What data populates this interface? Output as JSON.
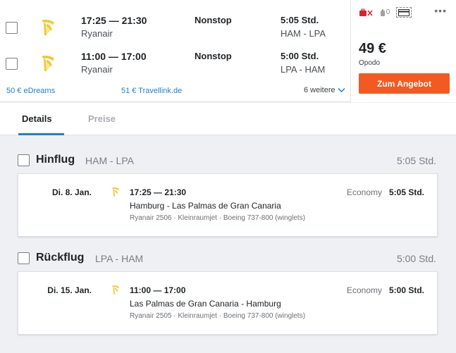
{
  "result": {
    "legs": [
      {
        "times": "17:25 — 21:30",
        "airline": "Ryanair",
        "stops": "Nonstop",
        "duration": "5:05 Std.",
        "route": "HAM - LPA",
        "logo": "ryanair-harp-icon"
      },
      {
        "times": "11:00 — 17:00",
        "airline": "Ryanair",
        "stops": "Nonstop",
        "duration": "5:00 Std.",
        "route": "LPA - HAM",
        "logo": "ryanair-harp-icon"
      }
    ],
    "providers": [
      {
        "label": "50 € eDreams"
      },
      {
        "label": "51 € Travellink.de"
      }
    ],
    "more_label": "6 weitere",
    "icons": {
      "bag_count": "0"
    },
    "price": "49 €",
    "vendor": "Opodo",
    "offer_button": "Zum Angebot",
    "colors": {
      "accent": "#1f7ecf",
      "cta": "#f25a22",
      "baggage_alert": "#d5242e"
    }
  },
  "tabs": [
    {
      "label": "Details",
      "active": true
    },
    {
      "label": "Preise",
      "active": false
    }
  ],
  "sections": [
    {
      "title": "Hinflug",
      "route": "HAM - LPA",
      "duration": "5:05 Std.",
      "segment": {
        "date": "Di. 8. Jan.",
        "times": "17:25 — 21:30",
        "route": "Hamburg - Las Palmas de Gran Canaria",
        "info": "Ryanair 2506 · Kleinraumjet · Boeing 737-800 (winglets)",
        "cabin": "Economy",
        "duration": "5:05 Std."
      }
    },
    {
      "title": "Rückflug",
      "route": "LPA - HAM",
      "duration": "5:00 Std.",
      "segment": {
        "date": "Di. 15. Jan.",
        "times": "11:00 — 17:00",
        "route": "Las Palmas de Gran Canaria - Hamburg",
        "info": "Ryanair 2505 · Kleinraumjet · Boeing 737-800 (winglets)",
        "cabin": "Economy",
        "duration": "5:00 Std."
      }
    }
  ]
}
